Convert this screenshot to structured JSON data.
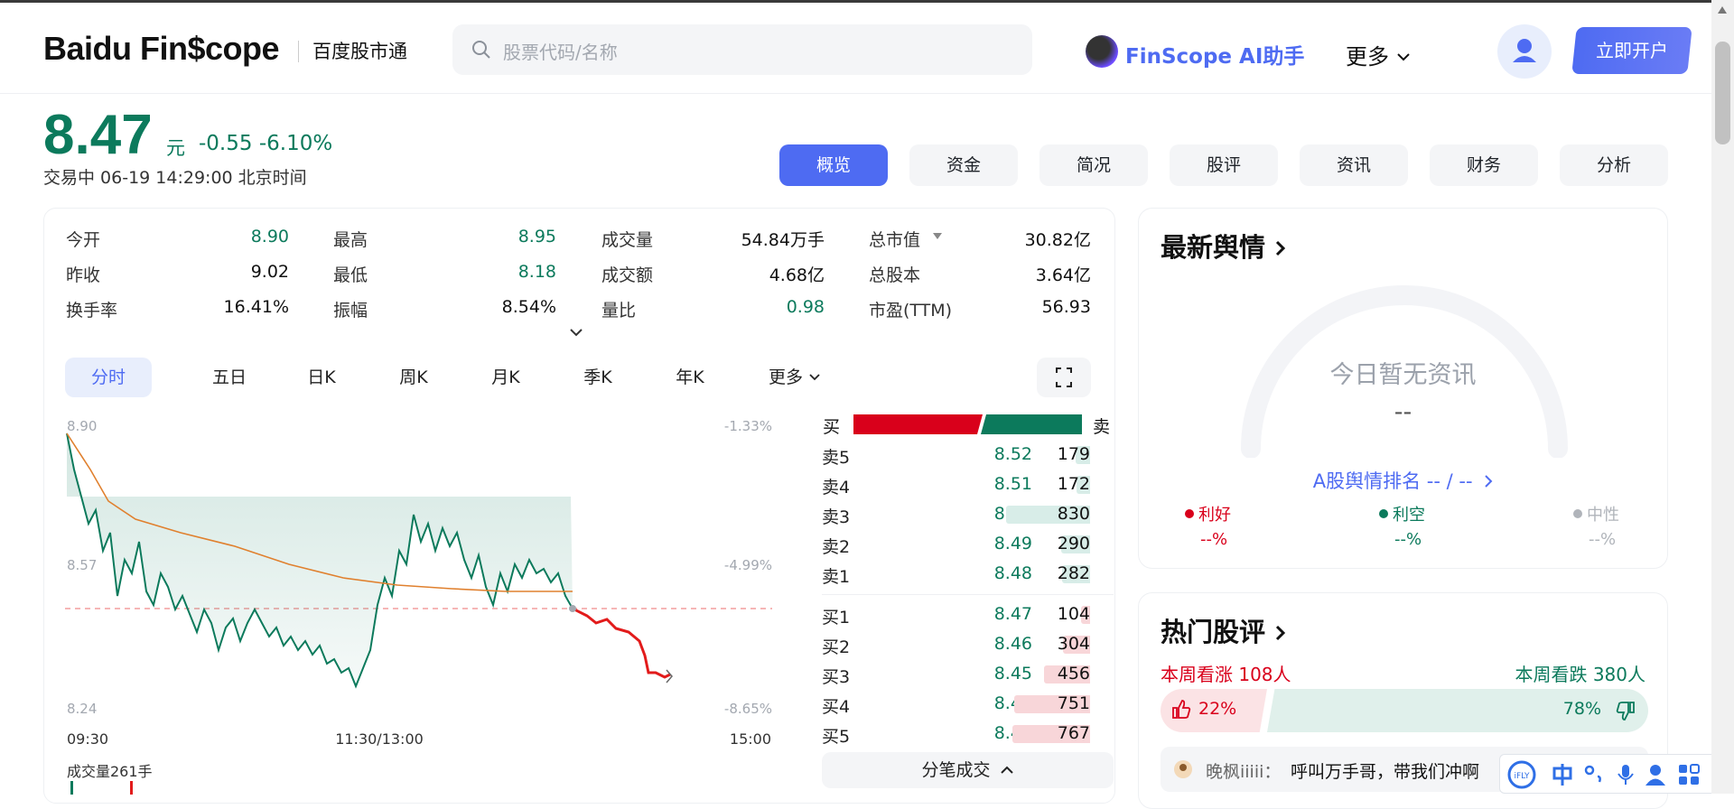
{
  "header": {
    "logo": "Baidu Fin$cope",
    "logo_sub": "百度股市通",
    "search_placeholder": "股票代码/名称",
    "ai_label": "FinScope AI助手",
    "more_label": "更多",
    "open_account": "立即开户"
  },
  "quote": {
    "price": "8.47",
    "unit": "元",
    "change": "-0.55  -6.10%",
    "status": "交易中  06-19 14:29:00  北京时间"
  },
  "tabs": [
    "概览",
    "资金",
    "简况",
    "股评",
    "资讯",
    "财务",
    "分析"
  ],
  "stats": [
    {
      "label": "今开",
      "value": "8.90"
    },
    {
      "label": "最高",
      "value": "8.95"
    },
    {
      "label": "成交量",
      "value": "54.84万手"
    },
    {
      "label": "总市值",
      "value": "30.82亿"
    },
    {
      "label": "昨收",
      "value": "9.02"
    },
    {
      "label": "最低",
      "value": "8.18"
    },
    {
      "label": "成交额",
      "value": "4.68亿"
    },
    {
      "label": "总股本",
      "value": "3.64亿"
    },
    {
      "label": "换手率",
      "value": "16.41%"
    },
    {
      "label": "振幅",
      "value": "8.54%"
    },
    {
      "label": "量比",
      "value": "0.98"
    },
    {
      "label": "市盈(TTM)",
      "value": "56.93"
    }
  ],
  "periods": [
    "分时",
    "五日",
    "日K",
    "周K",
    "月K",
    "季K",
    "年K",
    "更多"
  ],
  "chart_data": {
    "type": "line",
    "y_left_ticks": [
      "8.90",
      "8.57",
      "8.24"
    ],
    "y_right_ticks": [
      "-1.33%",
      "-4.99%",
      "-8.65%"
    ],
    "x_ticks": [
      "09:30",
      "11:30/13:00",
      "15:00"
    ],
    "ylim": [
      8.24,
      8.9
    ],
    "reference_close": 8.47,
    "volume_label": "成交量261手"
  },
  "orderbook": {
    "buy_label": "买",
    "sell_label": "卖",
    "sells": [
      {
        "label": "卖5",
        "price": "8.52",
        "vol": "179"
      },
      {
        "label": "卖4",
        "price": "8.51",
        "vol": "172"
      },
      {
        "label": "卖3",
        "price": "8.50",
        "vol": "830"
      },
      {
        "label": "卖2",
        "price": "8.49",
        "vol": "290"
      },
      {
        "label": "卖1",
        "price": "8.48",
        "vol": "282"
      }
    ],
    "buys": [
      {
        "label": "买1",
        "price": "8.47",
        "vol": "104"
      },
      {
        "label": "买2",
        "price": "8.46",
        "vol": "304"
      },
      {
        "label": "买3",
        "price": "8.45",
        "vol": "456"
      },
      {
        "label": "买4",
        "price": "8.44",
        "vol": "751"
      },
      {
        "label": "买5",
        "price": "8.43",
        "vol": "767"
      }
    ],
    "ticks_button": "分笔成交"
  },
  "sentiment": {
    "title": "最新舆情",
    "empty": "今日暂无资讯",
    "dash": "--",
    "rank": "A股舆情排名 -- / --",
    "legend": [
      {
        "label": "利好",
        "value": "--%",
        "color": "#d9001b"
      },
      {
        "label": "利空",
        "value": "--%",
        "color": "#0c7a5c"
      },
      {
        "label": "中性",
        "value": "--%",
        "color": "#b0b4ba"
      }
    ]
  },
  "hot": {
    "title": "热门股评",
    "up_label": "本周看涨 108人",
    "down_label": "本周看跌 380人",
    "up_pct": "22%",
    "down_pct": "78%",
    "comment_user": "晚枫iiiii：",
    "comment_text": "呼叫万手哥，带我们冲啊"
  }
}
